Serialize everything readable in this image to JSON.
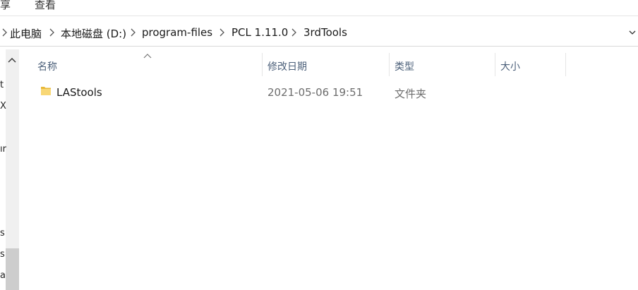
{
  "ribbon": {
    "tab_share": "享",
    "tab_view": "查看"
  },
  "breadcrumb": {
    "items": [
      "此电脑",
      "本地磁盘 (D:)",
      "program-files",
      "PCL 1.11.0",
      "3rdTools"
    ]
  },
  "nav_pane": {
    "clipped_labels": [
      "t",
      "X",
      "ır",
      "s",
      "s",
      "a"
    ]
  },
  "columns": {
    "name": "名称",
    "date": "修改日期",
    "type": "类型",
    "size": "大小"
  },
  "files": [
    {
      "name": "LAStools",
      "date": "2021-05-06 19:51",
      "type": "文件夹",
      "size": "",
      "icon": "folder-icon"
    }
  ],
  "colors": {
    "header_text": "#4c607a",
    "folder": "#e8b838",
    "scroll_thumb": "#cdcdcd"
  }
}
